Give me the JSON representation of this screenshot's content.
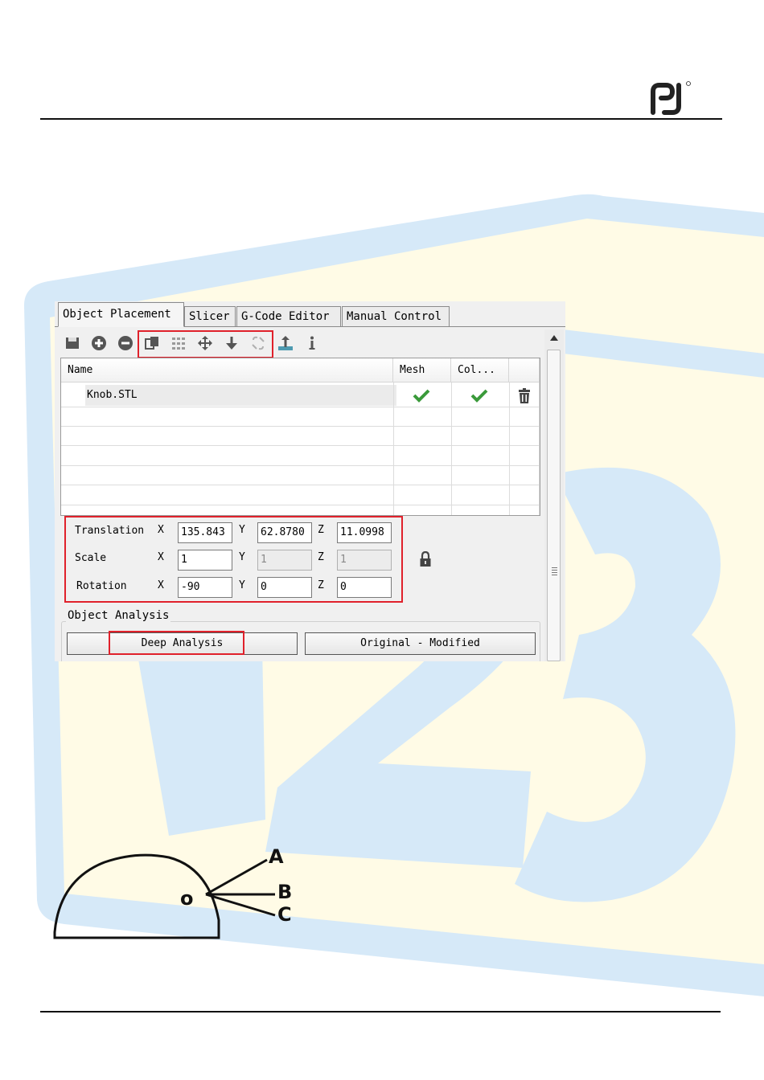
{
  "page": {
    "brand_logo": "brand-logo-icon",
    "watermark_text": "123",
    "colors": {
      "watermark_fill": "#fffbe6",
      "watermark_band": "#d6e9f8",
      "highlight": "#e0212b"
    }
  },
  "app": {
    "tabs": [
      {
        "label": "Object Placement",
        "active": true
      },
      {
        "label": "Slicer",
        "active": false
      },
      {
        "label": "G-Code Editor",
        "active": false
      },
      {
        "label": "Manual Control",
        "active": false
      }
    ],
    "toolbar": [
      "save-icon",
      "add-icon",
      "remove-icon",
      "copy-icon",
      "grid-arrange-icon",
      "center-icon",
      "drop-down-icon",
      "repair-icon",
      "land-icon",
      "info-icon"
    ],
    "list": {
      "columns": [
        "Name",
        "Mesh",
        "Col..."
      ],
      "rows": [
        {
          "name": "Knob.STL",
          "mesh": "check-icon",
          "collision": "check-icon",
          "action": "trash-icon"
        }
      ]
    },
    "transform": {
      "translation": {
        "label": "Translation",
        "x": "135.843",
        "y": "62.8780",
        "z": "11.0998"
      },
      "scale": {
        "label": "Scale",
        "x": "1",
        "y": "1",
        "z": "1"
      },
      "rotation": {
        "label": "Rotation",
        "x": "-90",
        "y": "0",
        "z": "0"
      },
      "axis_labels": [
        "X",
        "Y",
        "Z"
      ],
      "lock_icon": "lock-icon"
    },
    "analysis": {
      "title": "Object Analysis",
      "deep_button": "Deep Analysis",
      "compare_button": "Original - Modified"
    }
  },
  "diagram": {
    "center_label": "o",
    "line_labels": [
      "A",
      "B",
      "C"
    ]
  }
}
